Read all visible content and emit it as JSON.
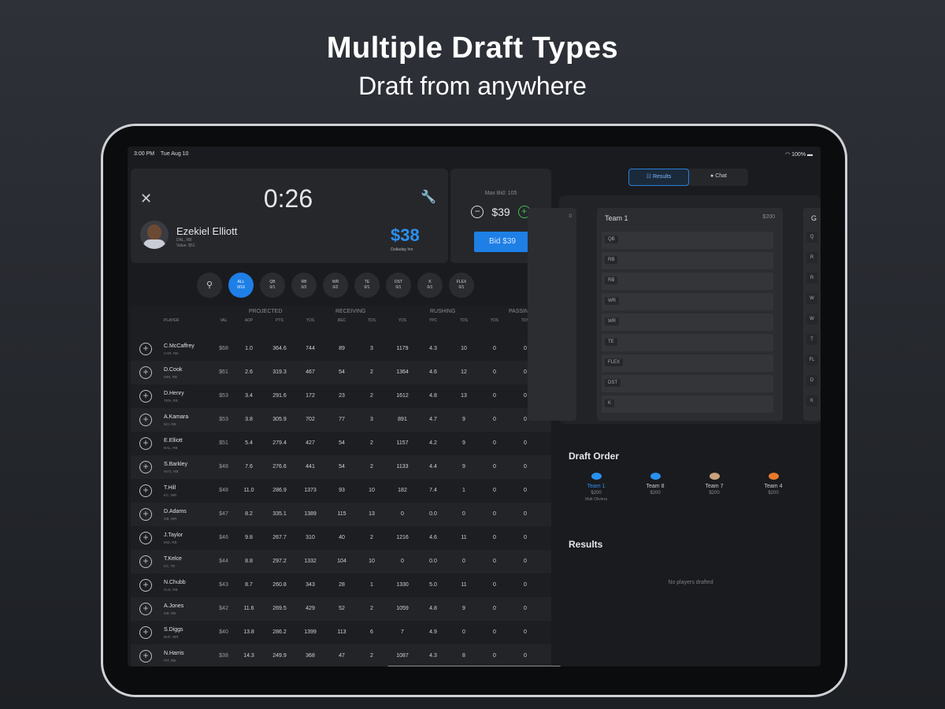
{
  "headline": {
    "title": "Multiple Draft Types",
    "subtitle": "Draft from anywhere"
  },
  "status_bar": {
    "time": "3:00 PM",
    "date": "Tue Aug 10",
    "battery": "100%"
  },
  "nomination": {
    "timer": "0:26",
    "player_name": "Ezekiel Elliott",
    "player_team": "DAL, RB",
    "player_value": "Value: $51",
    "current_price": "$38",
    "high_bidder": "Outladay Inn"
  },
  "bid_panel": {
    "max_bid_label": "Max Bid: 105",
    "bid_amount": "$39",
    "bid_button": "Bid $39"
  },
  "positions": [
    {
      "label": "ALL",
      "count": "0/16",
      "active": true
    },
    {
      "label": "QB",
      "count": "0/1"
    },
    {
      "label": "RB",
      "count": "0/2"
    },
    {
      "label": "WR",
      "count": "0/2"
    },
    {
      "label": "TE",
      "count": "0/1"
    },
    {
      "label": "DST",
      "count": "0/1"
    },
    {
      "label": "K",
      "count": "0/1"
    },
    {
      "label": "FLEX",
      "count": "0/1"
    }
  ],
  "table": {
    "groups": [
      "PROJECTED",
      "RECEIVING",
      "RUSHING",
      "PASSING"
    ],
    "columns": [
      "PLAYER",
      "VAL",
      "ADP",
      "PTS",
      "YDS",
      "REC",
      "TDS",
      "YDS",
      "YPC",
      "TDS",
      "YDS",
      "TDS"
    ],
    "rows": [
      {
        "name": "C.McCaffrey",
        "team": "CAR, RB",
        "cells": [
          "$68",
          "1.0",
          "364.6",
          "744",
          "89",
          "3",
          "1179",
          "4.3",
          "10",
          "0",
          "0"
        ]
      },
      {
        "name": "D.Cook",
        "team": "MIN, RB",
        "cells": [
          "$61",
          "2.6",
          "319.3",
          "467",
          "54",
          "2",
          "1364",
          "4.6",
          "12",
          "0",
          "0"
        ]
      },
      {
        "name": "D.Henry",
        "team": "TEN, RB",
        "cells": [
          "$53",
          "3.4",
          "291.6",
          "172",
          "23",
          "2",
          "1612",
          "4.8",
          "13",
          "0",
          "0"
        ]
      },
      {
        "name": "A.Kamara",
        "team": "NO, RB",
        "cells": [
          "$53",
          "3.8",
          "305.9",
          "702",
          "77",
          "3",
          "891",
          "4.7",
          "9",
          "0",
          "0"
        ]
      },
      {
        "name": "E.Elliott",
        "team": "DAL, RB",
        "cells": [
          "$51",
          "5.4",
          "279.4",
          "427",
          "54",
          "2",
          "1157",
          "4.2",
          "9",
          "0",
          "0"
        ]
      },
      {
        "name": "S.Barkley",
        "team": "NYG, RB",
        "cells": [
          "$48",
          "7.6",
          "276.6",
          "441",
          "54",
          "2",
          "1133",
          "4.4",
          "9",
          "0",
          "0"
        ]
      },
      {
        "name": "T.Hill",
        "team": "KC, WR",
        "cells": [
          "$48",
          "11.0",
          "286.9",
          "1373",
          "93",
          "10",
          "182",
          "7.4",
          "1",
          "0",
          "0"
        ]
      },
      {
        "name": "D.Adams",
        "team": "GB, WR",
        "cells": [
          "$47",
          "8.2",
          "335.1",
          "1389",
          "115",
          "13",
          "0",
          "0.0",
          "0",
          "0",
          "0"
        ]
      },
      {
        "name": "J.Taylor",
        "team": "IND, RB",
        "cells": [
          "$46",
          "9.8",
          "267.7",
          "310",
          "40",
          "2",
          "1216",
          "4.6",
          "11",
          "0",
          "0"
        ]
      },
      {
        "name": "T.Kelce",
        "team": "KC, TE",
        "cells": [
          "$44",
          "8.8",
          "297.2",
          "1332",
          "104",
          "10",
          "0",
          "0.0",
          "0",
          "0",
          "0"
        ]
      },
      {
        "name": "N.Chubb",
        "team": "CLE, RB",
        "cells": [
          "$43",
          "8.7",
          "260.8",
          "343",
          "28",
          "1",
          "1330",
          "5.0",
          "11",
          "0",
          "0"
        ]
      },
      {
        "name": "A.Jones",
        "team": "GB, RB",
        "cells": [
          "$42",
          "11.6",
          "269.5",
          "429",
          "52",
          "2",
          "1059",
          "4.8",
          "9",
          "0",
          "0"
        ]
      },
      {
        "name": "S.Diggs",
        "team": "BUF, WR",
        "cells": [
          "$40",
          "13.8",
          "286.2",
          "1399",
          "113",
          "6",
          "7",
          "4.9",
          "0",
          "0",
          "0"
        ]
      },
      {
        "name": "N.Harris",
        "team": "PIT, RB",
        "cells": [
          "$38",
          "14.3",
          "249.9",
          "368",
          "47",
          "2",
          "1087",
          "4.3",
          "8",
          "0",
          "0"
        ]
      }
    ]
  },
  "right_panel": {
    "tabs": [
      "Results",
      "Chat"
    ],
    "team_name": "Team 1",
    "team_budget": "$200",
    "slots": [
      "QB",
      "RB",
      "RB",
      "WR",
      "WR",
      "TE",
      "FLEX",
      "DST",
      "K"
    ],
    "right_partial_slots": [
      "Q",
      "R",
      "R",
      "W",
      "W",
      "T",
      "FL",
      "D",
      "K"
    ],
    "right_partial_head": "G",
    "left_partial_mark": ":0",
    "draft_order_title": "Draft Order",
    "draft_order": [
      {
        "name": "Team 1",
        "budget": "$200",
        "user": "Matt Oliviera",
        "color": "#2b90f0"
      },
      {
        "name": "Team 8",
        "budget": "$200",
        "color": "#2b90f0"
      },
      {
        "name": "Team 7",
        "budget": "$200",
        "color": "#c7a27a"
      },
      {
        "name": "Team 4",
        "budget": "$200",
        "color": "#e6792b"
      }
    ],
    "results_title": "Results",
    "empty_text": "No players drafted"
  },
  "colors": {
    "accent": "#1e7fe6",
    "plus": "#3fbf4f",
    "wrench": "#f0a030"
  }
}
